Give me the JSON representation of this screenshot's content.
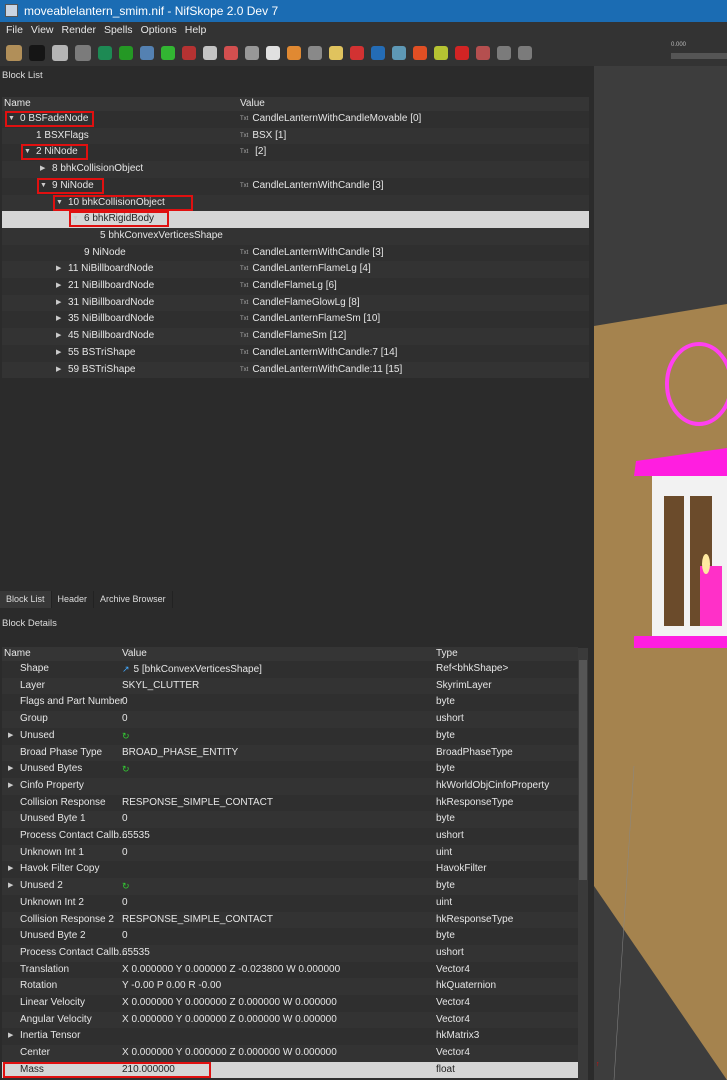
{
  "window": {
    "title": "moveablelantern_smim.nif - NifSkope 2.0 Dev 7"
  },
  "menu": [
    "File",
    "View",
    "Render",
    "Spells",
    "Options",
    "Help"
  ],
  "toolbar": {
    "slider_value": "0.000",
    "icons": [
      "load-icon",
      "save-icon",
      "undo-icon",
      "redo-icon",
      "select-object-icon",
      "select-vertex-icon",
      "view-top-icon",
      "view-front-icon",
      "view-side-icon",
      "view-walk-icon",
      "view-user-icon",
      "footprints-icon",
      "eye-icon",
      "eye-edit-icon",
      "screenshot-icon",
      "light-icon",
      "pin-icon",
      "axes-icon",
      "nodes-icon",
      "textures-icon",
      "lighting-icon",
      "marker-icon",
      "hide-icon",
      "play-icon",
      "loop-icon"
    ]
  },
  "block_list": {
    "title": "Block List",
    "columns": [
      "Name",
      "Value"
    ],
    "rows": [
      {
        "name": "0 BSFadeNode",
        "value": "CandleLanternWithCandleMovable [0]",
        "depth": 0,
        "arrow": "open",
        "highlight": true,
        "txt": true
      },
      {
        "name": "1 BSXFlags",
        "value": "BSX [1]",
        "depth": 1,
        "arrow": "",
        "highlight": false,
        "txt": true
      },
      {
        "name": "2 NiNode",
        "value": " [2]",
        "depth": 1,
        "arrow": "open",
        "highlight": true,
        "txt": true
      },
      {
        "name": "8 bhkCollisionObject",
        "value": "",
        "depth": 2,
        "arrow": "closed",
        "highlight": false,
        "txt": false
      },
      {
        "name": "9 NiNode",
        "value": "CandleLanternWithCandle [3]",
        "depth": 2,
        "arrow": "open",
        "highlight": true,
        "txt": true
      },
      {
        "name": "10 bhkCollisionObject",
        "value": "",
        "depth": 3,
        "arrow": "open",
        "highlight": true,
        "txt": false
      },
      {
        "name": "6 bhkRigidBody",
        "value": "",
        "depth": 4,
        "arrow": "open",
        "highlight": true,
        "txt": false,
        "selected": true
      },
      {
        "name": "5 bhkConvexVerticesShape",
        "value": "",
        "depth": 5,
        "arrow": "",
        "highlight": false,
        "txt": false
      },
      {
        "name": "9 NiNode",
        "value": "CandleLanternWithCandle [3]",
        "depth": 4,
        "arrow": "",
        "highlight": false,
        "txt": true
      },
      {
        "name": "11 NiBillboardNode",
        "value": "CandleLanternFlameLg [4]",
        "depth": 3,
        "arrow": "closed",
        "highlight": false,
        "txt": true
      },
      {
        "name": "21 NiBillboardNode",
        "value": "CandleFlameLg [6]",
        "depth": 3,
        "arrow": "closed",
        "highlight": false,
        "txt": true
      },
      {
        "name": "31 NiBillboardNode",
        "value": "CandleFlameGlowLg [8]",
        "depth": 3,
        "arrow": "closed",
        "highlight": false,
        "txt": true
      },
      {
        "name": "35 NiBillboardNode",
        "value": "CandleLanternFlameSm [10]",
        "depth": 3,
        "arrow": "closed",
        "highlight": false,
        "txt": true
      },
      {
        "name": "45 NiBillboardNode",
        "value": "CandleFlameSm [12]",
        "depth": 3,
        "arrow": "closed",
        "highlight": false,
        "txt": true
      },
      {
        "name": "55 BSTriShape",
        "value": "CandleLanternWithCandle:7 [14]",
        "depth": 3,
        "arrow": "closed",
        "highlight": false,
        "txt": true
      },
      {
        "name": "59 BSTriShape",
        "value": "CandleLanternWithCandle:11 [15]",
        "depth": 3,
        "arrow": "closed",
        "highlight": false,
        "txt": true
      }
    ]
  },
  "tabs": [
    "Block List",
    "Header",
    "Archive Browser"
  ],
  "block_details": {
    "title": "Block Details",
    "columns": [
      "Name",
      "Value",
      "Type"
    ],
    "rows": [
      {
        "name": "Shape",
        "value": "5 [bhkConvexVerticesShape]",
        "type": "Ref<bhkShape>",
        "expand": false,
        "icon": "link-icon"
      },
      {
        "name": "Layer",
        "value": "SKYL_CLUTTER",
        "type": "SkyrimLayer",
        "expand": false
      },
      {
        "name": "Flags and Part Number",
        "value": "0",
        "type": "byte",
        "expand": false
      },
      {
        "name": "Group",
        "value": "0",
        "type": "ushort",
        "expand": false
      },
      {
        "name": "Unused",
        "value": "",
        "type": "byte",
        "expand": true,
        "icon": "refresh-icon"
      },
      {
        "name": "Broad Phase Type",
        "value": "BROAD_PHASE_ENTITY",
        "type": "BroadPhaseType",
        "expand": false
      },
      {
        "name": "Unused Bytes",
        "value": "",
        "type": "byte",
        "expand": true,
        "icon": "refresh-icon"
      },
      {
        "name": "Cinfo Property",
        "value": "",
        "type": "hkWorldObjCinfoProperty",
        "expand": true
      },
      {
        "name": "Collision Response",
        "value": "RESPONSE_SIMPLE_CONTACT",
        "type": "hkResponseType",
        "expand": false
      },
      {
        "name": "Unused Byte 1",
        "value": "0",
        "type": "byte",
        "expand": false
      },
      {
        "name": "Process Contact Callb...",
        "value": "65535",
        "type": "ushort",
        "expand": false
      },
      {
        "name": "Unknown Int 1",
        "value": "0",
        "type": "uint",
        "expand": false
      },
      {
        "name": "Havok Filter Copy",
        "value": "",
        "type": "HavokFilter",
        "expand": true
      },
      {
        "name": "Unused 2",
        "value": "",
        "type": "byte",
        "expand": true,
        "icon": "refresh-icon"
      },
      {
        "name": "Unknown Int 2",
        "value": "0",
        "type": "uint",
        "expand": false
      },
      {
        "name": "Collision Response 2",
        "value": "RESPONSE_SIMPLE_CONTACT",
        "type": "hkResponseType",
        "expand": false
      },
      {
        "name": "Unused Byte 2",
        "value": "0",
        "type": "byte",
        "expand": false
      },
      {
        "name": "Process Contact Callb...",
        "value": "65535",
        "type": "ushort",
        "expand": false
      },
      {
        "name": "Translation",
        "value": "X 0.000000 Y 0.000000 Z -0.023800 W 0.000000",
        "type": "Vector4",
        "expand": false
      },
      {
        "name": "Rotation",
        "value": "Y -0.00 P 0.00 R -0.00",
        "type": "hkQuaternion",
        "expand": false
      },
      {
        "name": "Linear Velocity",
        "value": "X 0.000000 Y 0.000000 Z 0.000000 W 0.000000",
        "type": "Vector4",
        "expand": false
      },
      {
        "name": "Angular Velocity",
        "value": "X 0.000000 Y 0.000000 Z 0.000000 W 0.000000",
        "type": "Vector4",
        "expand": false
      },
      {
        "name": "Inertia Tensor",
        "value": "",
        "type": "hkMatrix3",
        "expand": true
      },
      {
        "name": "Center",
        "value": "X 0.000000 Y 0.000000 Z 0.000000 W 0.000000",
        "type": "Vector4",
        "expand": false
      },
      {
        "name": "Mass",
        "value": "210.000000",
        "type": "float",
        "expand": false,
        "selected": true,
        "highlight": true
      }
    ]
  },
  "colors": {
    "highlight": "#e01010",
    "title_bar": "#1b6cb3",
    "lantern": "#ff1ee0",
    "floor": "#a5834e"
  }
}
